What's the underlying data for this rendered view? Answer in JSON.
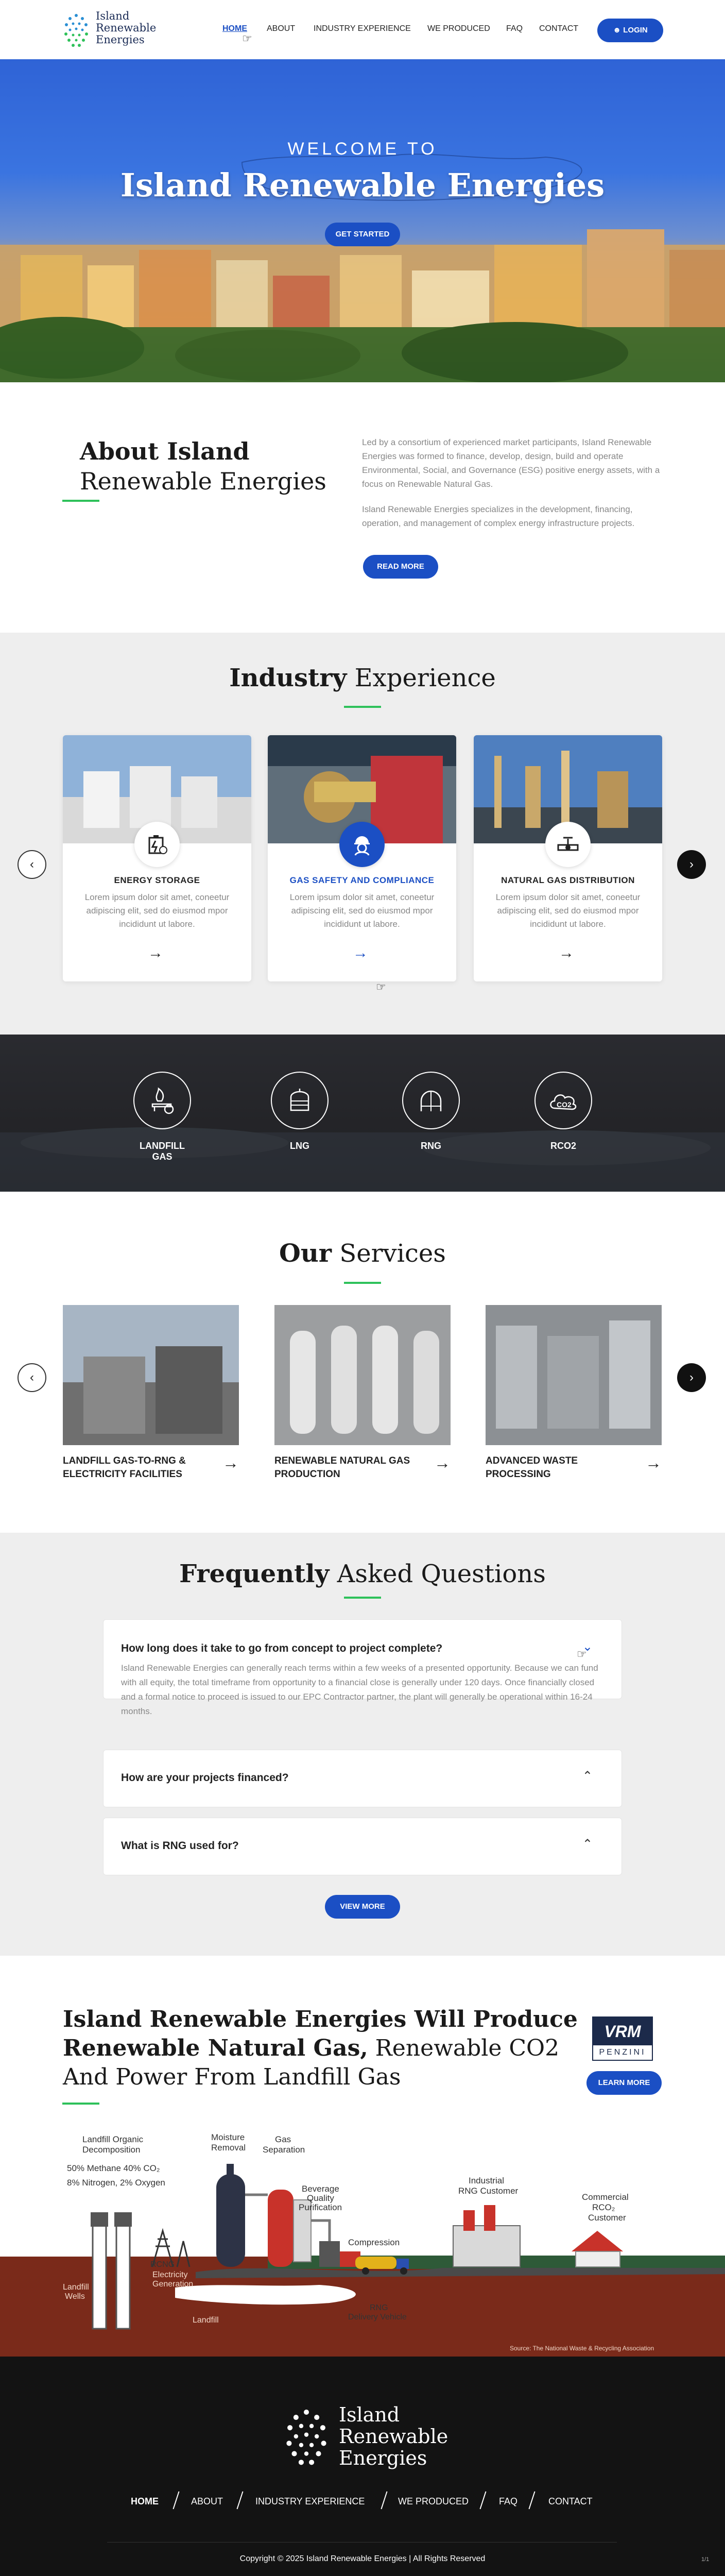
{
  "header": {
    "logo_line1": "Island",
    "logo_line2": "Renewable",
    "logo_line3": "Energies",
    "nav": [
      "HOME",
      "ABOUT",
      "INDUSTRY EXPERIENCE",
      "WE PRODUCED",
      "FAQ",
      "CONTACT"
    ],
    "login_label": "LOGIN",
    "accent": "#1b4fc4"
  },
  "hero": {
    "kicker": "WELCOME TO",
    "title": "Island Renewable Energies",
    "cta": "GET STARTED"
  },
  "about": {
    "title_bold": "About Island",
    "title_light": "Renewable Energies",
    "para1": "Led by a consortium of experienced market participants, Island Renewable Energies was formed to finance, develop, design, build and operate Environmental, Social, and Governance (ESG) positive energy assets, with a focus on Renewable Natural Gas.",
    "para2": "Island Renewable Energies specializes in the development, financing, operation, and management of complex energy infrastructure projects.",
    "cta": "READ MORE"
  },
  "industry": {
    "title_bold": "Industry",
    "title_light": "Experience",
    "cards": [
      {
        "title": "ENERGY STORAGE",
        "text": "Lorem ipsum dolor sit amet, coneetur adipiscing elit, sed do eiusmod mpor incididunt ut labore.",
        "icon": "battery-icon"
      },
      {
        "title": "GAS SAFETY AND COMPLIANCE",
        "text": "Lorem ipsum dolor sit amet, coneetur adipiscing elit, sed do eiusmod mpor incididunt ut labore.",
        "icon": "worker-icon"
      },
      {
        "title": "NATURAL GAS DISTRIBUTION",
        "text": "Lorem ipsum dolor sit amet, coneetur adipiscing elit, sed do eiusmod mpor incididunt ut labore.",
        "icon": "pipe-valve-icon"
      }
    ]
  },
  "features": {
    "items": [
      {
        "label": "LANDFILL GAS",
        "icon": "flame-bin-icon"
      },
      {
        "label": "LNG",
        "icon": "tank-icon"
      },
      {
        "label": "RNG",
        "icon": "rng-globe-icon"
      },
      {
        "label": "RCO2",
        "icon": "co2-cloud-icon"
      }
    ]
  },
  "services": {
    "title_bold": "Our",
    "title_light": "Services",
    "items": [
      {
        "title": "LANDFILL GAS-TO-RNG & ELECTRICITY FACILITIES"
      },
      {
        "title": "RENEWABLE NATURAL GAS PRODUCTION"
      },
      {
        "title": "ADVANCED WASTE PROCESSING"
      }
    ]
  },
  "faq": {
    "title_bold": "Frequently",
    "title_light": "Asked Questions",
    "items": [
      {
        "q": "How long does it take to go from concept to project complete?",
        "a": "Island Renewable Energies can generally reach terms within a few weeks of a presented opportunity. Because we can fund with all equity, the total timeframe from opportunity to a financial close is generally under 120 days.  Once financially closed and a formal notice to proceed is issued to our EPC Contractor partner, the plant will generally be operational within 16-24 months."
      },
      {
        "q": "How are your projects financed?"
      },
      {
        "q": "What is RNG used for?"
      }
    ],
    "cta": "VIEW MORE"
  },
  "produce": {
    "line1": "Island Renewable Energies Will Produce",
    "line2_bold": "Renewable Natural Gas,",
    "line2_light": " Renewable CO2",
    "line3": "And Power From Landfill Gas",
    "partner_top": "VRM",
    "partner_bottom": "PENZINI",
    "cta": "LEARN MORE",
    "diagram": {
      "l1": "Landfill Organic",
      "l2": "Decomposition",
      "l3": "50% Methane 40% CO₂",
      "l4": "8% Nitrogen, 2% Oxygen",
      "moisture1": "Moisture",
      "moisture2": "Removal",
      "gas1": "Gas",
      "gas2": "Separation",
      "bev1": "Beverage",
      "bev2": "Quality",
      "bev3": "Purification",
      "comp": "Compression",
      "ind1": "Industrial",
      "ind2": "RNG Customer",
      "com1": "Commercial",
      "com2": "RCO₂",
      "com3": "Customer",
      "rcng1": "RCNG",
      "rcng2": "Electricity",
      "rcng3": "Generation",
      "wells1": "Landfill",
      "wells2": "Wells",
      "landfill": "Landfill",
      "rng1": "RNG",
      "rng2": "Delivery Vehicle",
      "source": "Source: The National Waste & Recycling Association"
    }
  },
  "footer": {
    "logo_line1": "Island",
    "logo_line2": "Renewable",
    "logo_line3": "Energies",
    "nav": [
      "HOME",
      "ABOUT",
      "INDUSTRY EXPERIENCE",
      "WE PRODUCED",
      "FAQ",
      "CONTACT"
    ],
    "copyright": "Copyright © 2025 Island Renewable Energies | All Rights Reserved",
    "page_num": "1/1"
  }
}
